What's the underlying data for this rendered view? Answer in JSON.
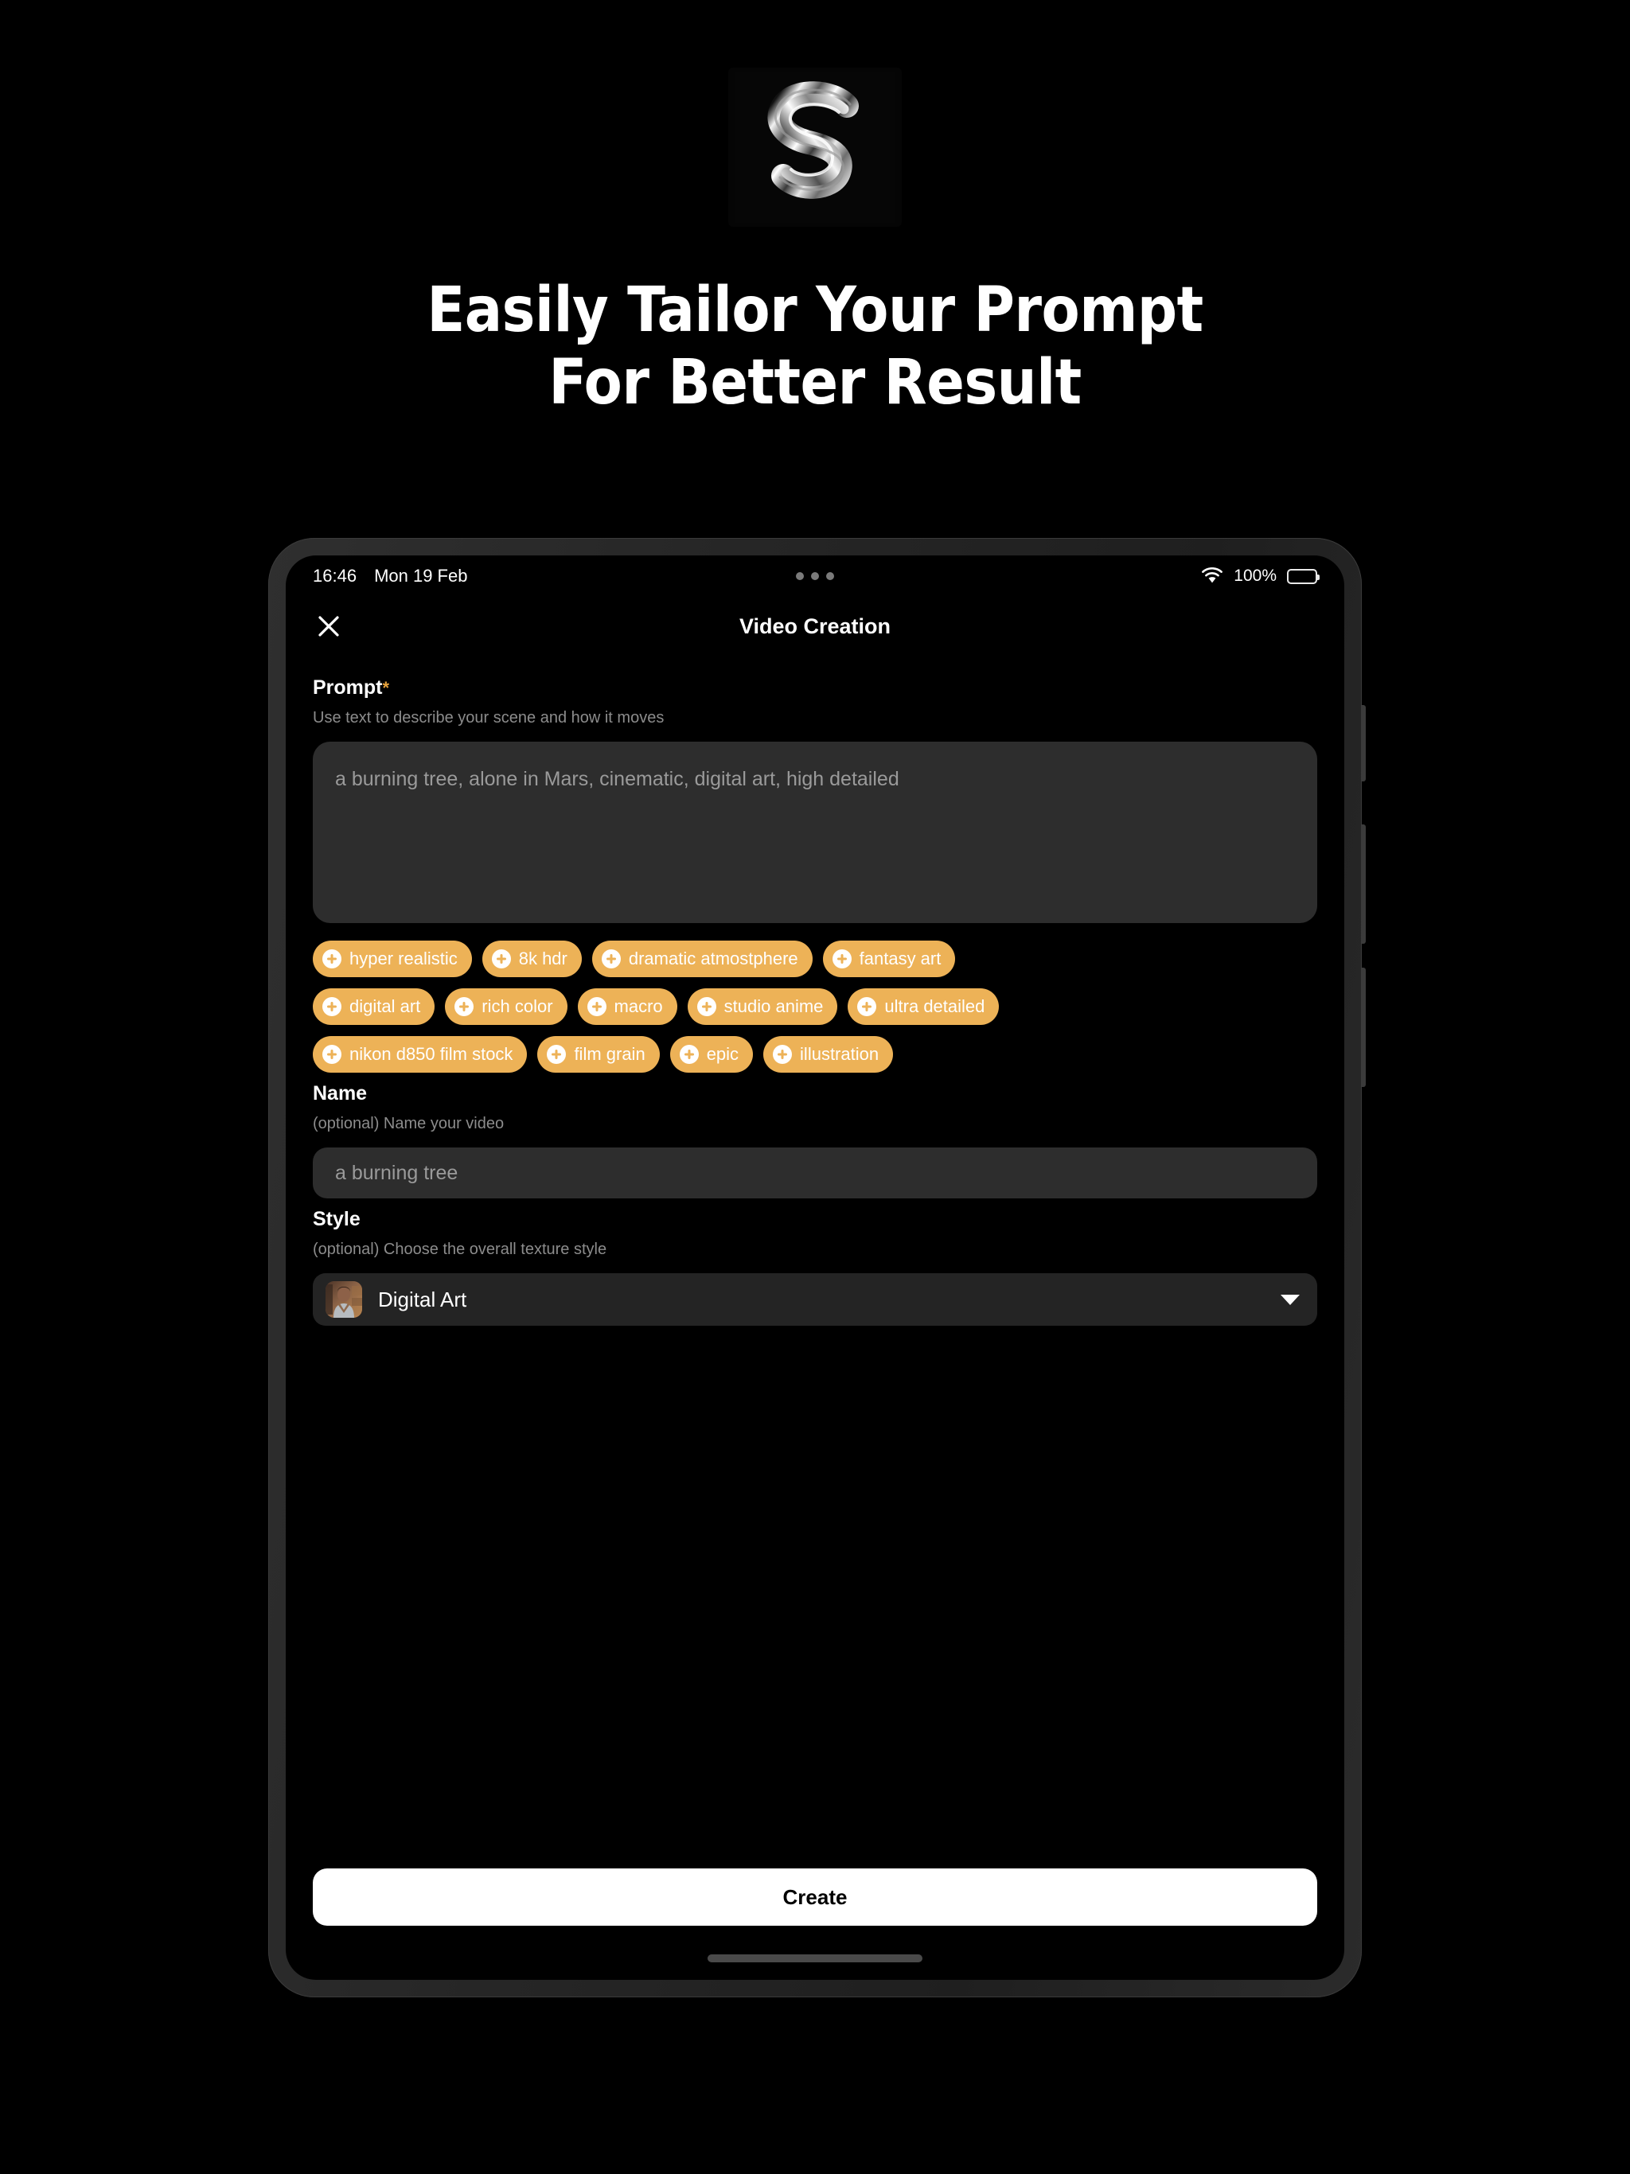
{
  "marketing": {
    "logo_icon": "chrome-letter-s-logo",
    "headline_line1": "Easily Tailor Your Prompt",
    "headline_line2": "For Better Result"
  },
  "status_bar": {
    "time": "16:46",
    "date": "Mon 19 Feb",
    "center_indicator_icon": "three-dots-indicator",
    "wifi_icon": "wifi-icon",
    "battery_percent": "100%",
    "battery_icon": "battery-full-icon"
  },
  "app": {
    "close_icon": "close-icon",
    "title": "Video Creation"
  },
  "form": {
    "prompt": {
      "label": "Prompt",
      "required_marker": "*",
      "hint": "Use text to describe your scene and how it moves",
      "value": "a burning tree, alone in Mars, cinematic, digital art, high detailed",
      "placeholder": "a burning tree, alone in Mars, cinematic, digital art, high detailed"
    },
    "tags": [
      "hyper realistic",
      "8k hdr",
      "dramatic atmostphere",
      "fantasy art",
      "digital art",
      "rich color",
      "macro",
      "studio anime",
      "ultra detailed",
      "nikon d850 film stock",
      "film grain",
      "epic",
      "illustration"
    ],
    "name": {
      "label": "Name",
      "hint": "(optional) Name your video",
      "value": "a burning tree",
      "placeholder": "a burning tree"
    },
    "style": {
      "label": "Style",
      "hint": "(optional) Choose the overall texture style",
      "selected": "Digital Art",
      "thumbnail_icon": "style-portrait-thumbnail",
      "caret_icon": "chevron-down-icon"
    }
  },
  "footer": {
    "create_label": "Create",
    "home_indicator_icon": "home-indicator"
  },
  "colors": {
    "accent": "#edb257",
    "background": "#000000",
    "field_background": "#2d2d2d",
    "cta_background": "#ffffff",
    "hint_text": "#8c8c8c"
  }
}
